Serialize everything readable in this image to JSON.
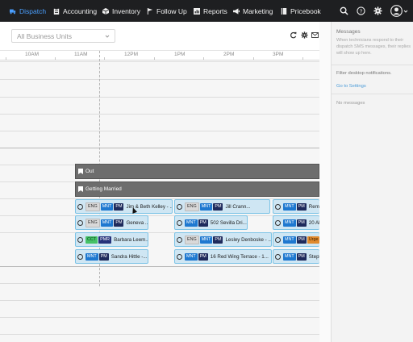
{
  "nav": {
    "items": [
      {
        "label": "Dispatch",
        "icon": "truck-icon"
      },
      {
        "label": "Accounting",
        "icon": "clipboard-icon"
      },
      {
        "label": "Inventory",
        "icon": "box-icon"
      },
      {
        "label": "Follow Up",
        "icon": "flag-icon"
      },
      {
        "label": "Reports",
        "icon": "chart-icon"
      },
      {
        "label": "Marketing",
        "icon": "megaphone-icon"
      },
      {
        "label": "Pricebook",
        "icon": "book-icon"
      }
    ],
    "active_color": "#4a9fff"
  },
  "toolbar": {
    "business_units_placeholder": "All Business Units"
  },
  "timeline": {
    "hours": [
      "10AM",
      "11AM",
      "12PM",
      "1PM",
      "2PM",
      "3PM"
    ]
  },
  "bars": [
    {
      "label": "Out"
    },
    {
      "label": "Getting Married"
    }
  ],
  "jobs": [
    {
      "tags": [
        "ENG",
        "MNT",
        "PM"
      ],
      "title": "Jim & Beth Kelley - ..."
    },
    {
      "tags": [
        "ENG",
        "MNT",
        "PM"
      ],
      "title": "Jill Crann..."
    },
    {
      "tags": [
        "MNT",
        "PM"
      ],
      "title": "Remo..."
    },
    {
      "tags": [
        "ENG",
        "MNT",
        "PM"
      ],
      "title": "Geneva ..."
    },
    {
      "tags": [
        "MNT",
        "PM"
      ],
      "title": "502 Sevilla Dri..."
    },
    {
      "tags": [
        "MNT",
        "PM"
      ],
      "title": "20 Al..."
    },
    {
      "tags": [
        "CCT",
        "PMR"
      ],
      "title": "Barbara Leem..."
    },
    {
      "tags": [
        "ENG",
        "MNT",
        "PM"
      ],
      "title": "Lesley Denboske - ..."
    },
    {
      "tags": [
        "MNT",
        "PM",
        "Urge"
      ],
      "title": ""
    },
    {
      "tags": [
        "MNT",
        "PM"
      ],
      "title": "Sandra Hittle -..."
    },
    {
      "tags": [
        "MNT",
        "PM"
      ],
      "title": "16 Red Wing Terrace - 1..."
    },
    {
      "tags": [
        "MNT",
        "PM"
      ],
      "title": "Steph..."
    }
  ],
  "panel": {
    "title": "Messages",
    "description": "When technicians respond to their dispatch SMS messages, their replies will show up here.",
    "filter_text": "Filter desktop notifications.",
    "settings_link": "Go to Settings",
    "empty_text": "No messages"
  }
}
